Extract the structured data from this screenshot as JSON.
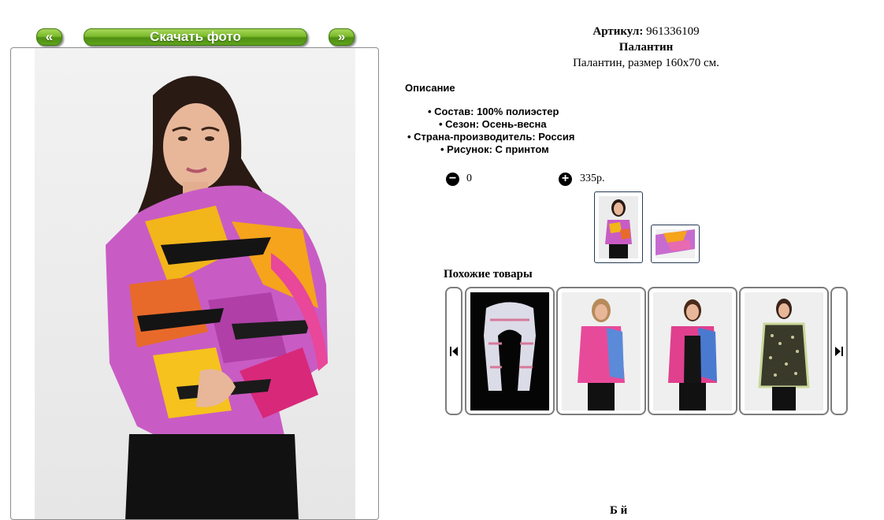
{
  "nav": {
    "prev_label": "«",
    "download_label": "Скачать фото",
    "next_label": "»"
  },
  "product": {
    "article_label": "Артикул:",
    "article_value": "961336109",
    "name": "Палантин",
    "subtitle": "Палантин, размер 160x70 см."
  },
  "description": {
    "heading": "Описание",
    "specs": [
      "• Состав: 100% полиэстер",
      "• Сезон: Осень-весна",
      "• Страна-производитель: Россия",
      "• Рисунок: С принтом"
    ]
  },
  "quantity": {
    "value": "0",
    "price": "335р."
  },
  "similar": {
    "title": "Похожие товары"
  },
  "footer": {
    "partial_text": "Б й"
  },
  "colors": {
    "button_green": "#6aac22",
    "card_border": "#7d7d7d",
    "thumb_border": "#243b55"
  },
  "icons": {
    "minus": "minus-circle-icon",
    "plus": "plus-circle-icon",
    "prev": "skip-prev-icon",
    "next": "skip-next-icon"
  }
}
